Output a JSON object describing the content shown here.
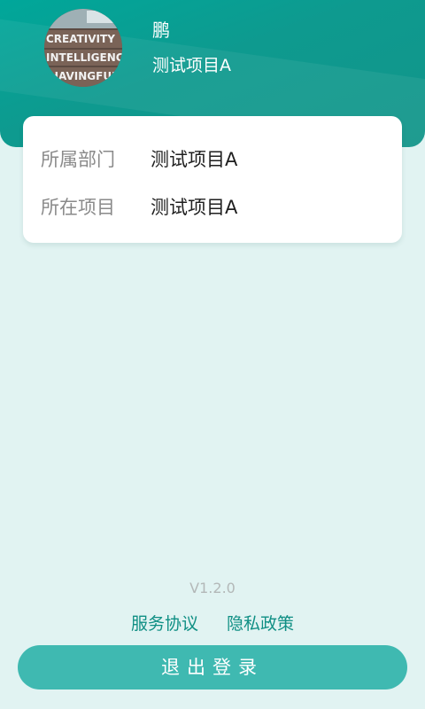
{
  "profile": {
    "name": "鹏",
    "project": "测试项目A",
    "avatar_text": [
      "CREATIVITY",
      "INTELLIGENCE",
      "HAVINGFUN"
    ]
  },
  "info": {
    "rows": [
      {
        "label": "所属部门",
        "value": "测试项目A"
      },
      {
        "label": "所在项目",
        "value": "测试项目A"
      }
    ]
  },
  "footer": {
    "version": "V1.2.0",
    "service_agreement": "服务协议",
    "privacy_policy": "隐私政策",
    "logout_label": "退出登录"
  },
  "colors": {
    "header": "#12958a",
    "background": "#e1f3f2",
    "accent": "#3fb9b1",
    "link": "#0f8f84"
  }
}
